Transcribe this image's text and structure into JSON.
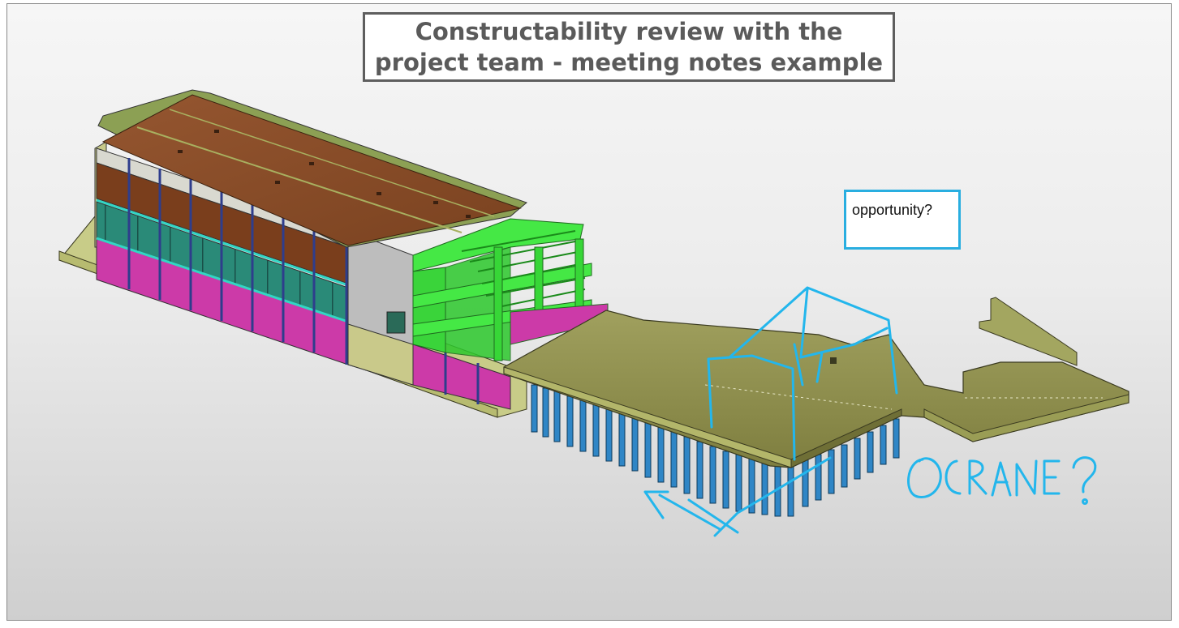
{
  "slide": {
    "title": "Constructability review with the project team - meeting notes example"
  },
  "annotation": {
    "note_text": "opportunity?",
    "handwritten_text": "OCRANE?"
  },
  "colors": {
    "ink": "#23b6ec",
    "roof": "#8b4f27",
    "slab": "#8c8c4b",
    "steel": "#35e035",
    "magenta": "#cc3aa8",
    "glass": "#2a8a78",
    "piles": "#2f86c6"
  },
  "icons": {
    "model": "bim-3d-model",
    "markup": "freehand-markup"
  }
}
